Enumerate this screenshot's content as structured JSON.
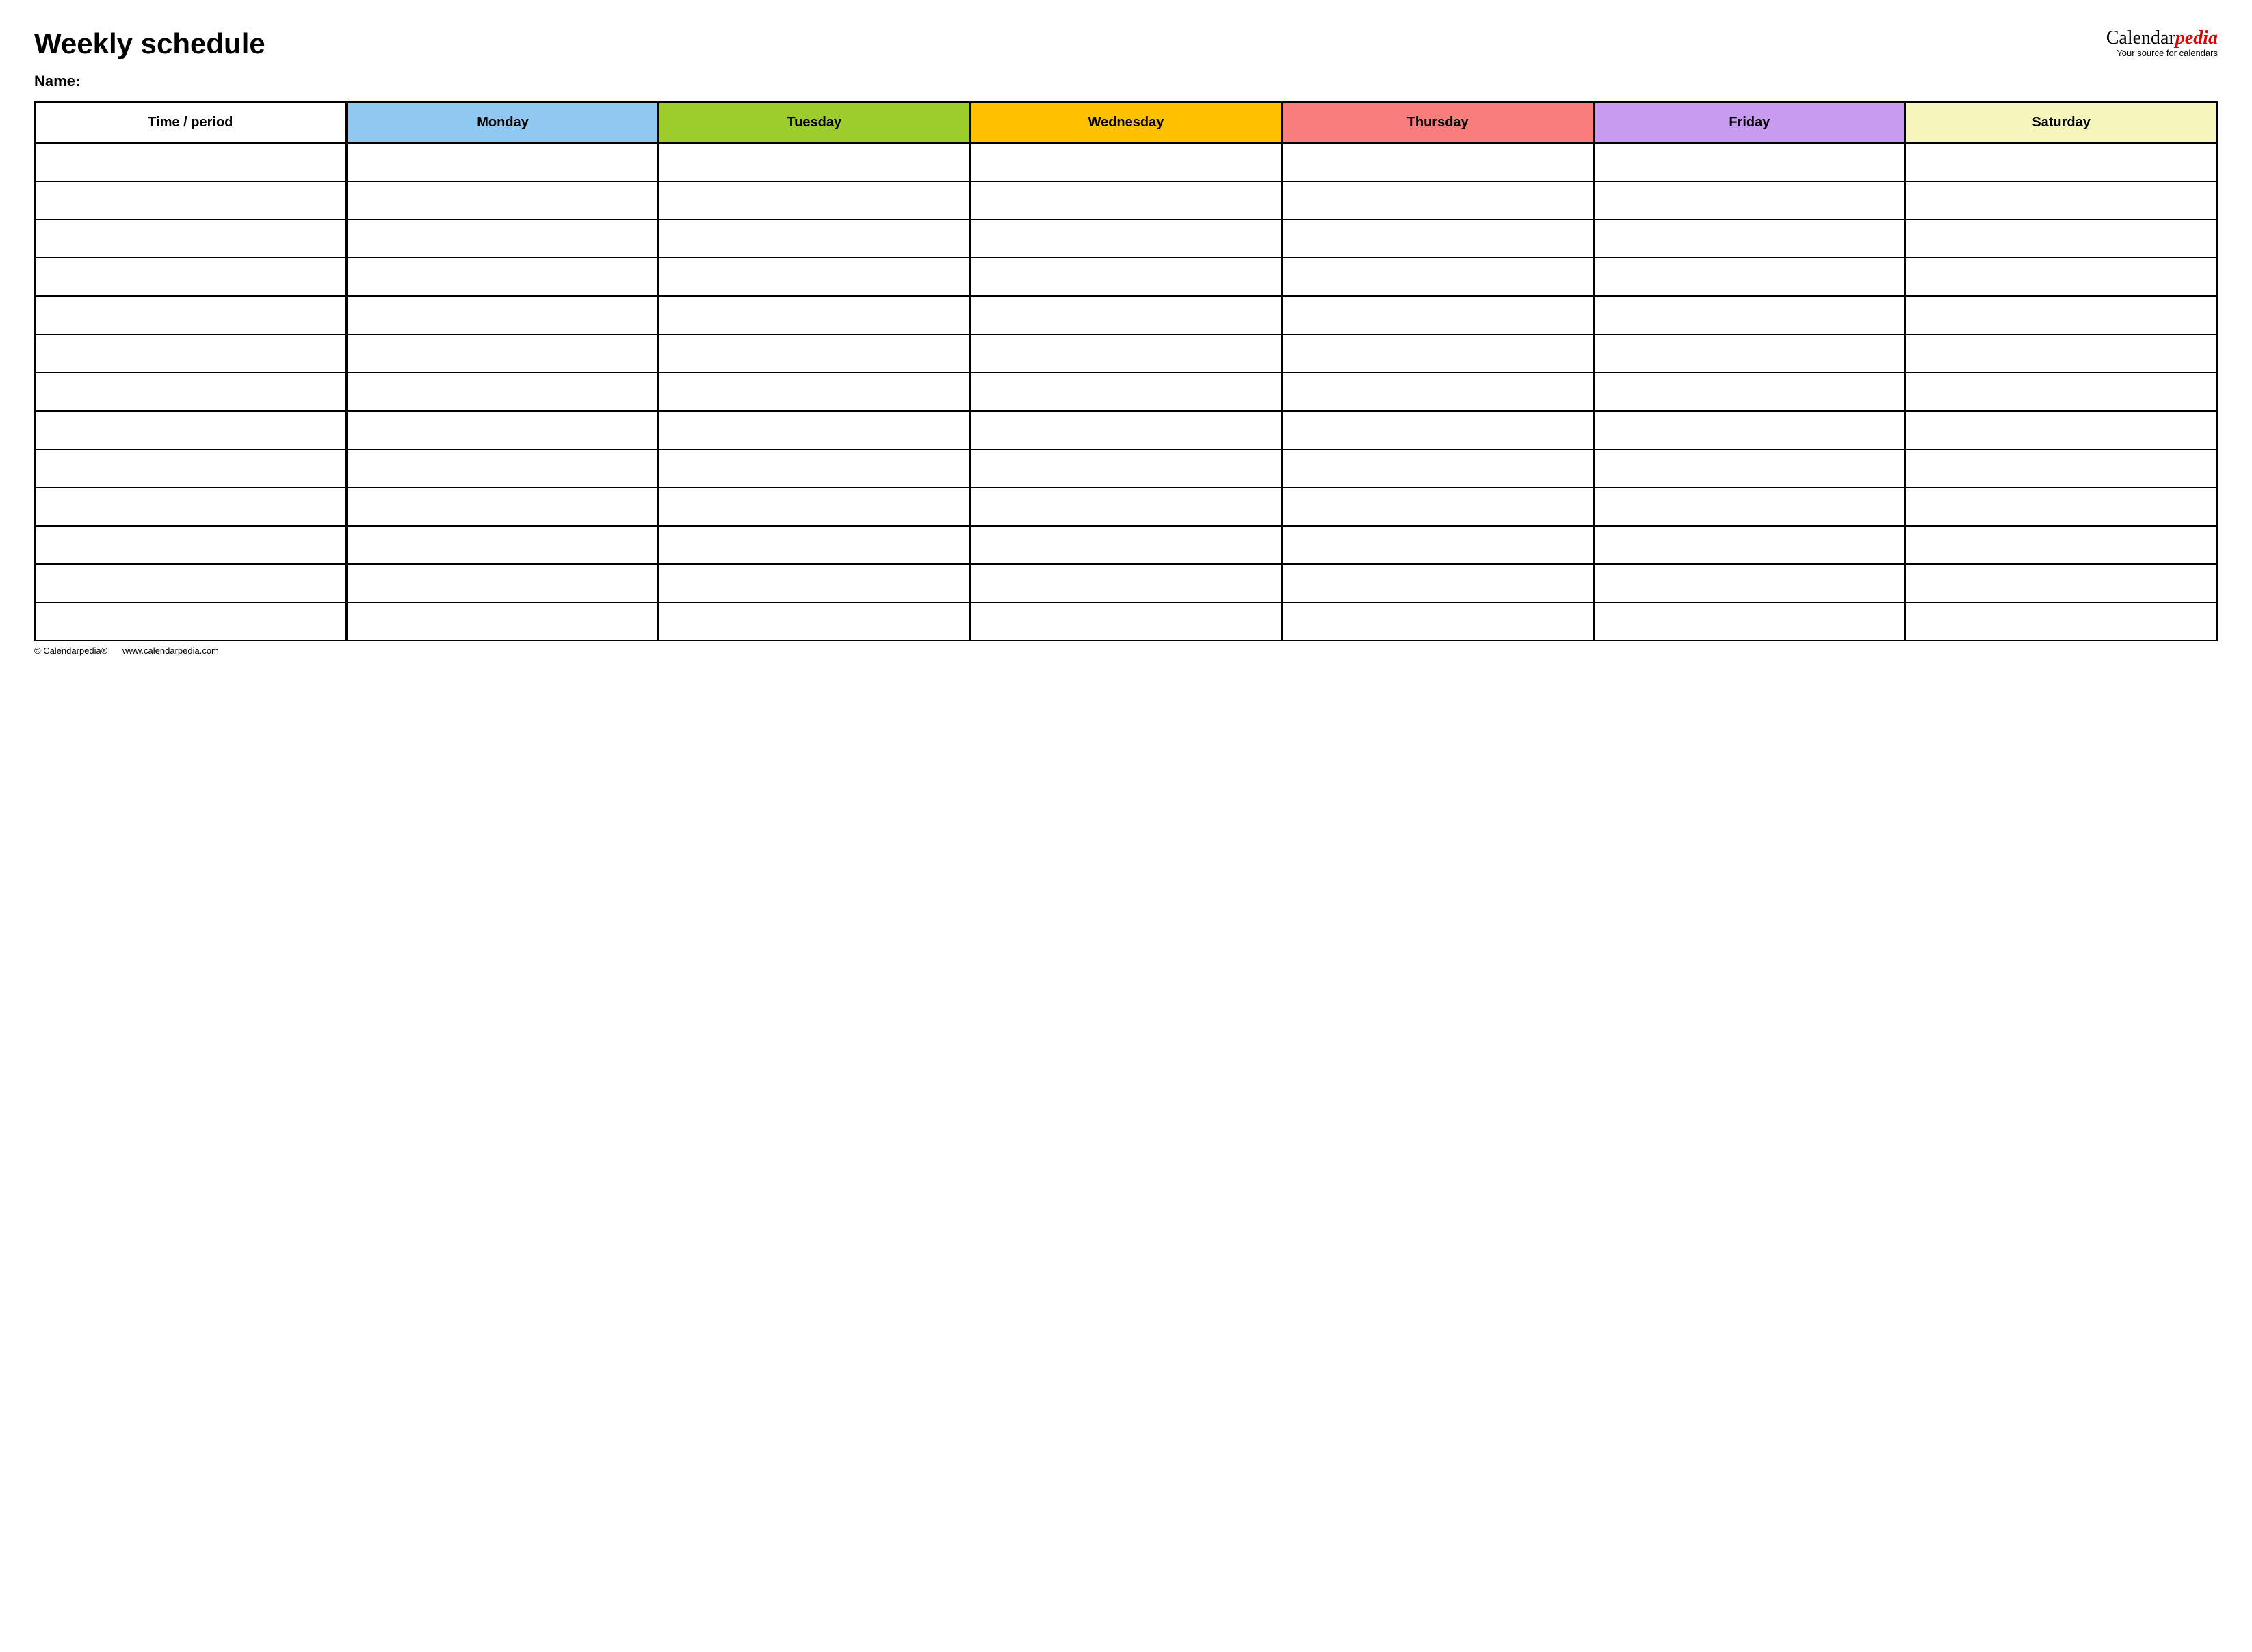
{
  "header": {
    "title": "Weekly schedule",
    "name_label": "Name:",
    "logo_prefix": "Calendar",
    "logo_suffix": "pedia",
    "logo_tagline": "Your source for calendars"
  },
  "table": {
    "time_header": "Time / period",
    "days": [
      {
        "label": "Monday",
        "color": "#8fc8f0"
      },
      {
        "label": "Tuesday",
        "color": "#9ccd2c"
      },
      {
        "label": "Wednesday",
        "color": "#ffc000"
      },
      {
        "label": "Thursday",
        "color": "#f97d7d"
      },
      {
        "label": "Friday",
        "color": "#c89bf0"
      },
      {
        "label": "Saturday",
        "color": "#f6f5bc"
      }
    ],
    "num_rows": 13
  },
  "footer": {
    "copyright": "© Calendarpedia®",
    "url": "www.calendarpedia.com"
  }
}
